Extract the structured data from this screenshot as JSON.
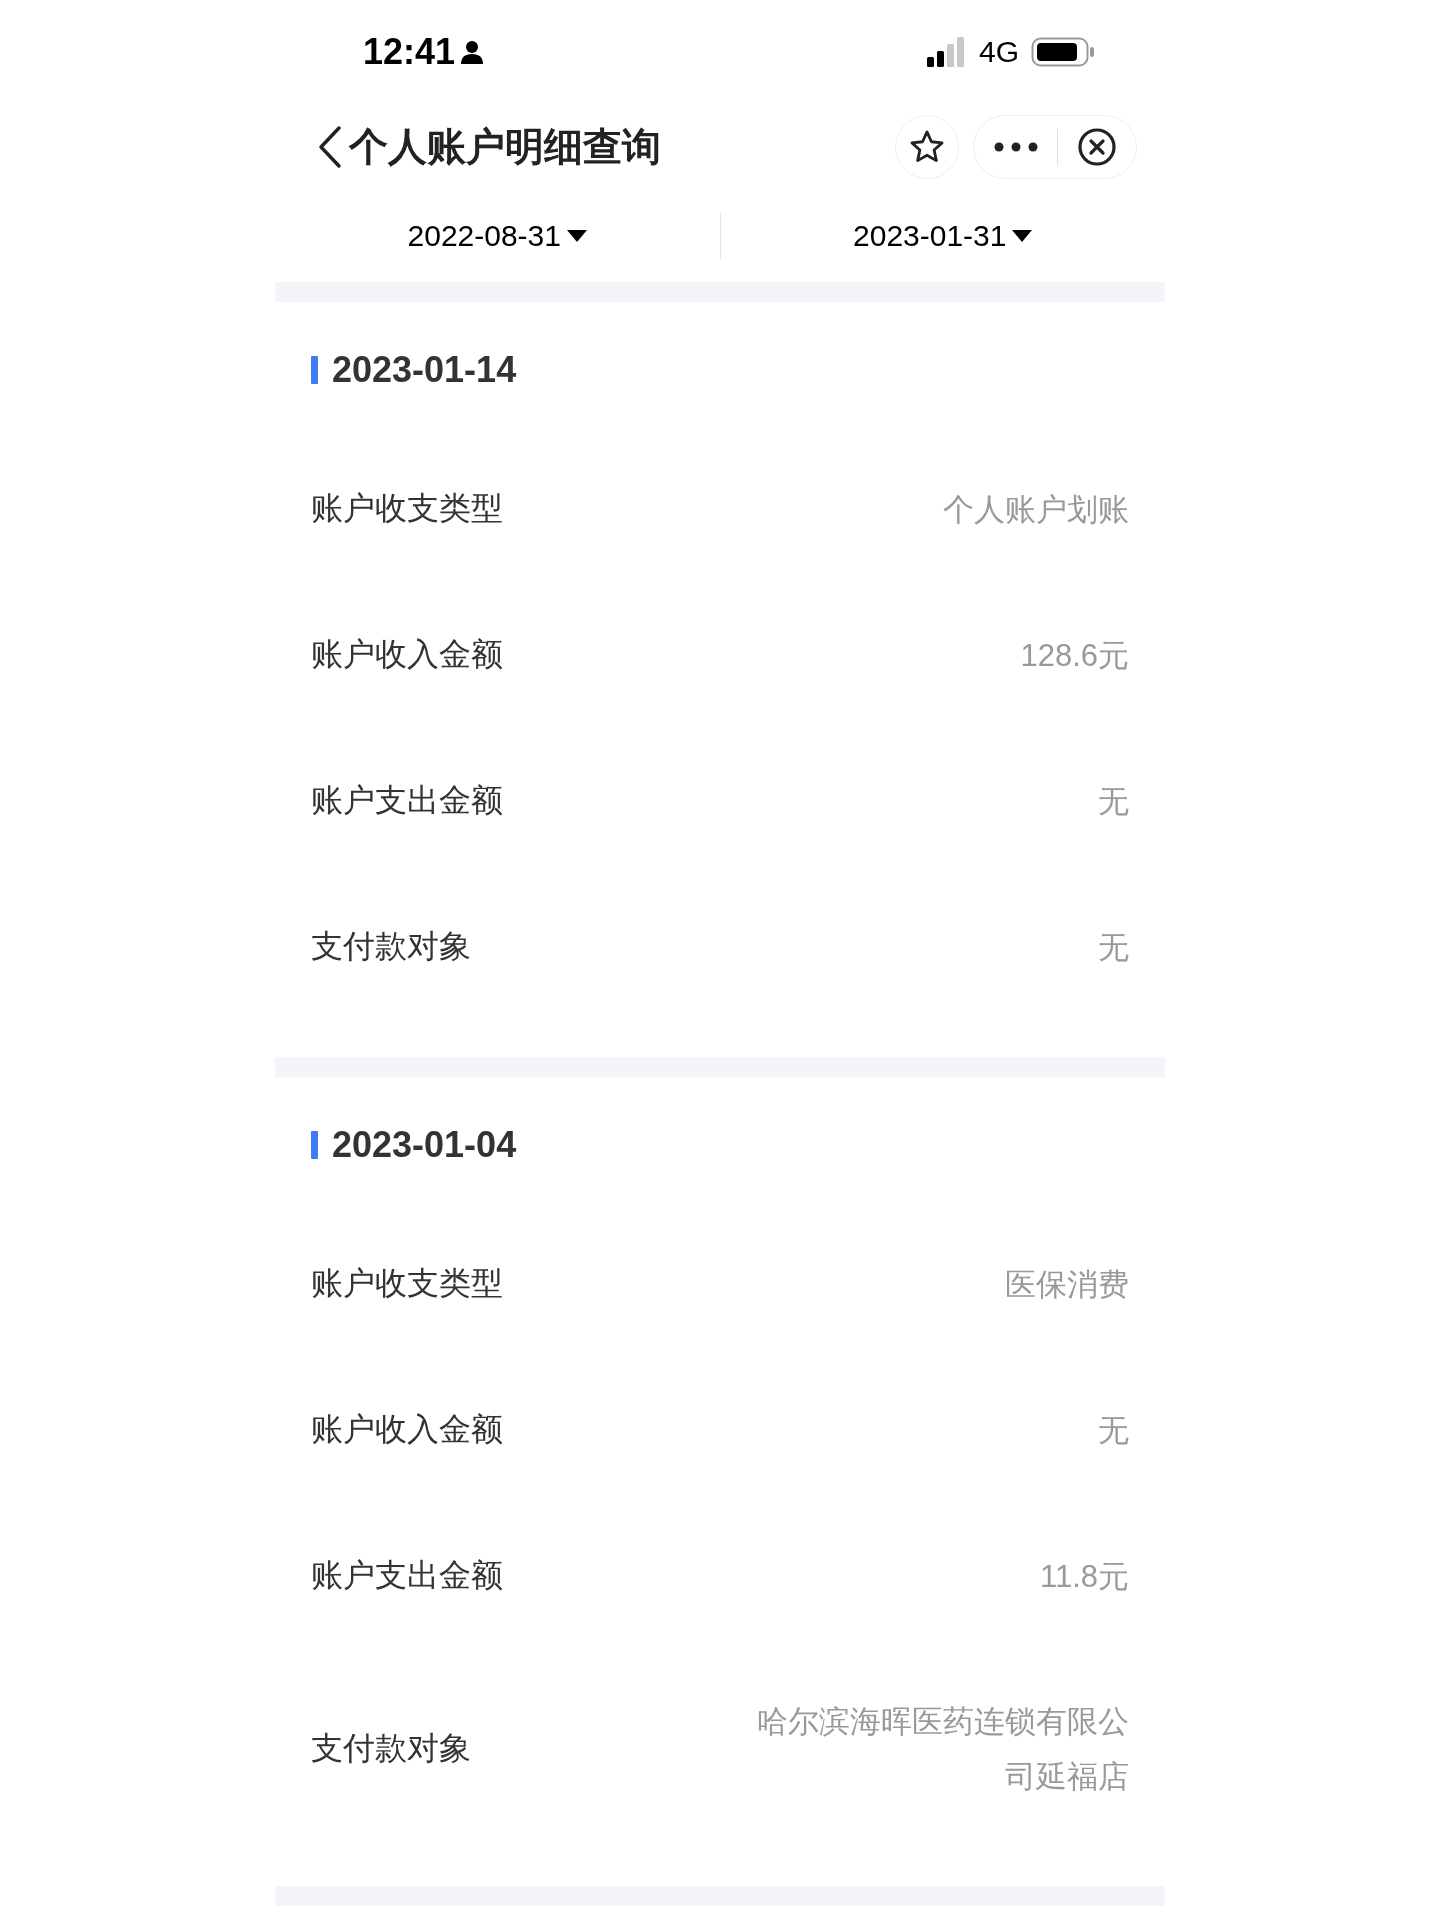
{
  "status_bar": {
    "time": "12:41",
    "network": "4G"
  },
  "nav": {
    "title": "个人账户明细查询"
  },
  "date_range": {
    "start": "2022-08-31",
    "end": "2023-01-31"
  },
  "records": [
    {
      "date": "2023-01-14",
      "fields": [
        {
          "label": "账户收支类型",
          "value": "个人账户划账"
        },
        {
          "label": "账户收入金额",
          "value": "128.6元"
        },
        {
          "label": "账户支出金额",
          "value": "无"
        },
        {
          "label": "支付款对象",
          "value": "无"
        }
      ]
    },
    {
      "date": "2023-01-04",
      "fields": [
        {
          "label": "账户收支类型",
          "value": "医保消费"
        },
        {
          "label": "账户收入金额",
          "value": "无"
        },
        {
          "label": "账户支出金额",
          "value": "11.8元"
        },
        {
          "label": "支付款对象",
          "value": "哈尔滨海晖医药连锁有限公司延福店"
        }
      ]
    }
  ]
}
